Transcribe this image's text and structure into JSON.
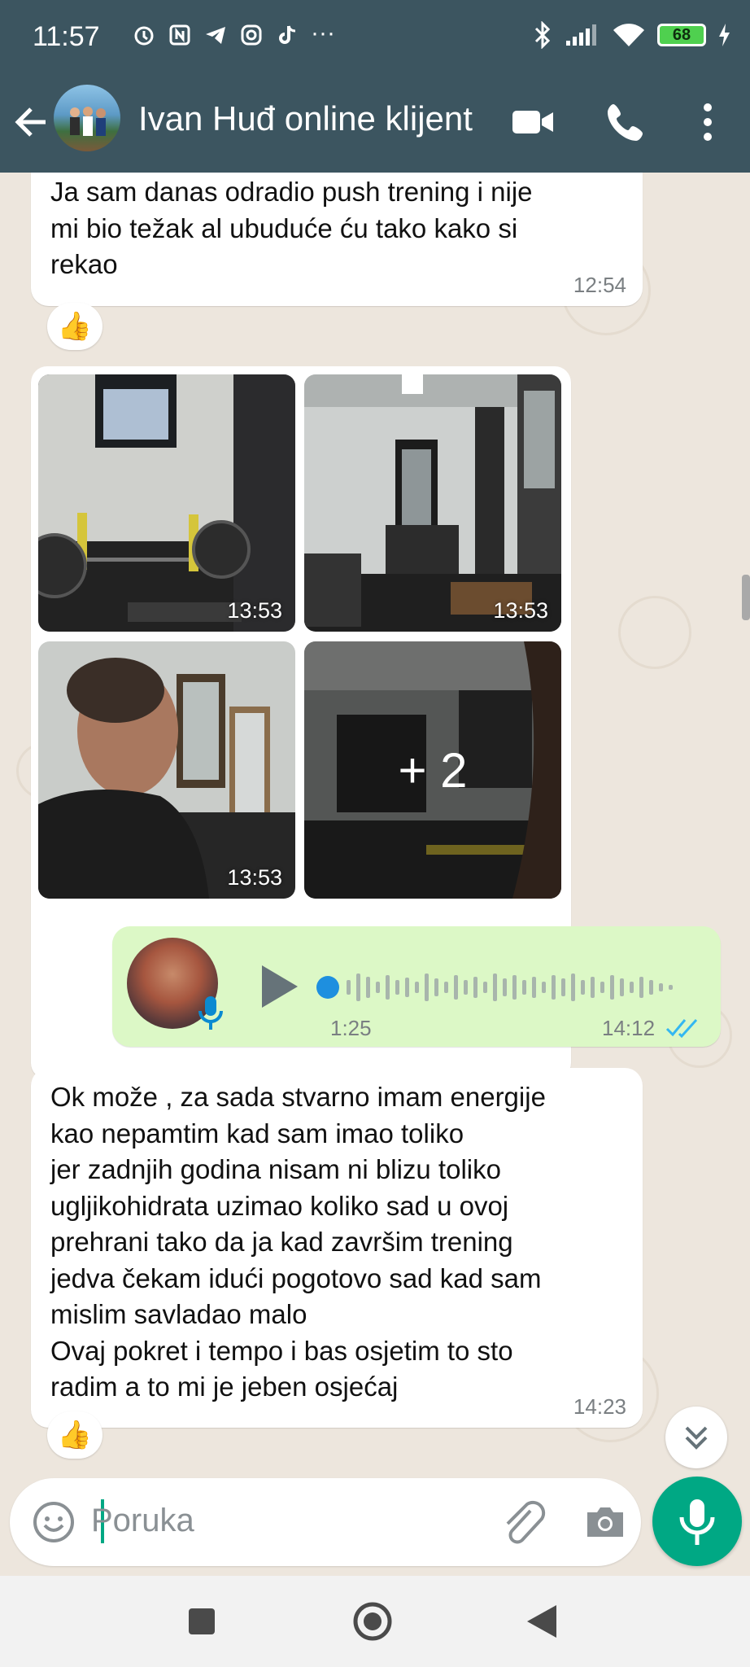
{
  "status_bar": {
    "time": "11:57",
    "battery": "68",
    "more": "···"
  },
  "header": {
    "title": "Ivan Huđ online klijent"
  },
  "messages": {
    "m1": {
      "text": "Ja sam danas odradio push trening i nije\nmi bio težak al ubuduće ću tako kako si\nrekao",
      "time": "12:54",
      "reaction": "👍"
    },
    "photos": {
      "t1": "13:53",
      "t2": "13:53",
      "t3": "13:53",
      "more": "+ 2"
    },
    "voice": {
      "duration": "1:25",
      "time": "14:12"
    },
    "m2": {
      "text": "Ok može , za sada stvarno imam energije\nkao nepamtim kad sam imao toliko\njer zadnjih godina nisam ni blizu toliko\nugljikohidrata uzimao koliko sad u ovoj\nprehrani tako da ja kad završim trening\njedva čekam idući pogotovo sad kad sam\nmislim savladao malo\nOvaj pokret i tempo i bas osjetim to sto\nradim a to mi je jeben osjećaj",
      "time": "14:23",
      "reaction": "👍"
    }
  },
  "input": {
    "placeholder": "Poruka"
  },
  "colors": {
    "header": "#3c5560",
    "accent": "#00a884",
    "outgoing_bubble": "#dcf8c6",
    "chat_bg": "#ede6dd"
  },
  "icons": [
    "back-arrow-icon",
    "video-call-icon",
    "phone-icon",
    "more-vert-icon",
    "thumbs-up-icon",
    "play-icon",
    "mic-icon",
    "emoji-icon",
    "attach-icon",
    "camera-icon",
    "scroll-down-icon",
    "read-ticks-icon",
    "recent-apps-icon",
    "home-icon",
    "back-icon"
  ]
}
